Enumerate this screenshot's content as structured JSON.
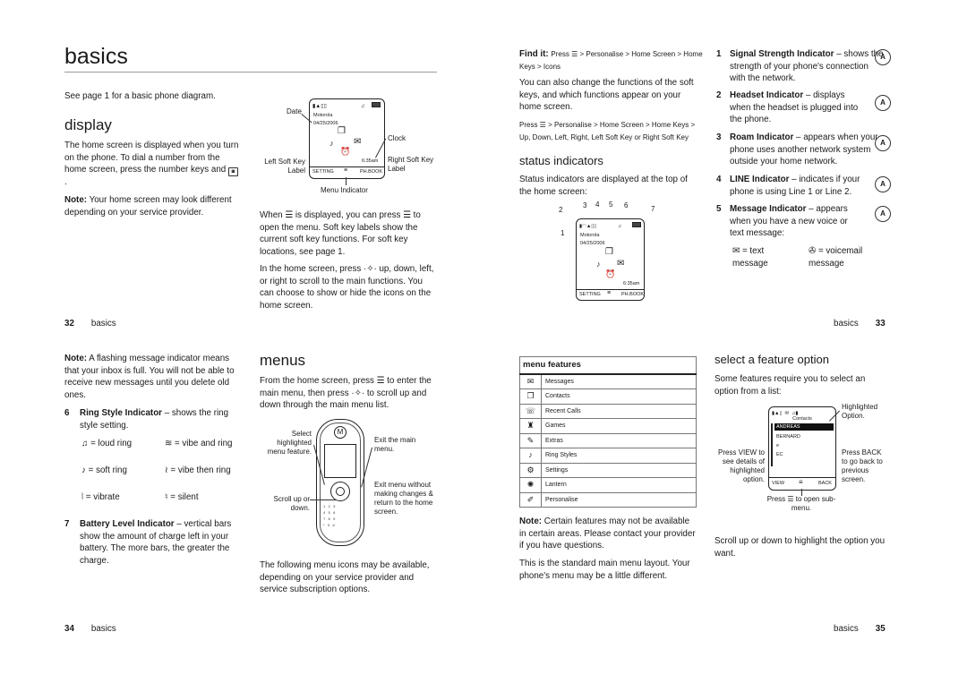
{
  "page32": {
    "title": "basics",
    "intro": "See page 1 for a basic phone diagram.",
    "section": "display",
    "para1": "The home screen is displayed when you turn on the phone. To dial a number from the home screen, press the number keys and",
    "note_label": "Note:",
    "note_text": "Your home screen may look different depending on your service provider.",
    "diagram": {
      "labels": {
        "date": "Date",
        "clock": "Clock",
        "left_soft_key": "Left Soft Key Label",
        "right_soft_key": "Right Soft Key Label",
        "menu_indicator": "Menu Indicator"
      },
      "screen": {
        "carrier": "Motorola",
        "date": "04/25/2006",
        "time": "6:35am",
        "left_soft": "SETTING",
        "right_soft": "PH.BOOK"
      }
    },
    "para2": "When ☰ is displayed, you can press ☰ to open the menu. Soft key labels show the current soft key functions. For soft key locations, see page 1.",
    "para3": "In the home screen, press ·✧· up, down, left, or right to scroll to the main functions. You can choose to show or hide the icons on the home screen.",
    "folio_num": "32",
    "folio_label": "basics"
  },
  "page33": {
    "findit_label": "Find it:",
    "findit_text": "Press ☰ > Personalise > Home Screen > Home Keys > Icons",
    "para1": "You can also change the functions of the soft keys, and which functions appear on your home screen.",
    "para2": "Press ☰ > Personalise > Home Screen > Home Keys > Up, Down, Left, Right, Left Soft Key or Right Soft Key",
    "section": "status indicators",
    "para3": "Status indicators are displayed at the top of the home screen:",
    "callouts": [
      "1",
      "2",
      "3",
      "4",
      "5",
      "6",
      "7"
    ],
    "screen": {
      "carrier": "Motorola",
      "date": "04/25/2006",
      "time": "6:35am",
      "left_soft": "SETTING",
      "right_soft": "PH.BOOK"
    },
    "indicators": [
      {
        "num": "1",
        "title": "Signal Strength Indicator",
        "text": " – shows the strength of your phone's connection with the network."
      },
      {
        "num": "2",
        "title": "Headset Indicator",
        "text": " – displays when the headset is plugged into the phone."
      },
      {
        "num": "3",
        "title": "Roam Indicator",
        "text": " – appears when your phone uses another network system outside your home network."
      },
      {
        "num": "4",
        "title": "LINE Indicator",
        "text": " – indicates if your phone is using Line 1 or Line 2."
      },
      {
        "num": "5",
        "title": "Message Indicator",
        "text": " – appears when you have a new voice or text message:"
      }
    ],
    "msg_types": [
      {
        "icon": "text-message-icon",
        "glyph": "✉",
        "label": "= text message"
      },
      {
        "icon": "voicemail-icon",
        "glyph": "✇",
        "label": "= voicemail message"
      }
    ],
    "folio_label": "basics",
    "folio_num": "33"
  },
  "page34": {
    "note_label": "Note:",
    "note_text": "A flashing message indicator means that your inbox is full. You will not be able to receive new messages until you delete old ones.",
    "item6_num": "6",
    "item6_title": "Ring Style Indicator",
    "item6_text": " – shows the ring style setting.",
    "ring_styles": [
      {
        "glyph": "♫",
        "label": "= loud ring"
      },
      {
        "glyph": "≋",
        "label": "= vibe and ring"
      },
      {
        "glyph": "♪",
        "label": "= soft ring"
      },
      {
        "glyph": "≀",
        "label": "= vibe then ring"
      },
      {
        "glyph": "⦚",
        "label": "= vibrate"
      },
      {
        "glyph": "♮",
        "label": "= silent"
      }
    ],
    "item7_num": "7",
    "item7_title": "Battery Level Indicator",
    "item7_text": " – vertical bars show the amount of charge left in your battery. The more bars, the greater the charge.",
    "section": "menus",
    "para1": "From the home screen, press ☰ to enter the main menu, then press ·✧· to scroll up and down through the main menu list.",
    "phone_labels": {
      "select": "Select highlighted menu feature.",
      "exit_main": "Exit the main menu.",
      "scroll": "Scroll up or down.",
      "exit_without": "Exit menu without making changes & return to the home screen."
    },
    "para2": "The following menu icons may be available, depending on your service provider and service subscription options.",
    "folio_num": "34",
    "folio_label": "basics"
  },
  "page35": {
    "menu_table": {
      "header": "menu features",
      "rows": [
        {
          "icon": "messages-icon",
          "glyph": "✉",
          "label": "Messages"
        },
        {
          "icon": "contacts-icon",
          "glyph": "❐",
          "label": "Contacts"
        },
        {
          "icon": "recent-calls-icon",
          "glyph": "☏",
          "label": "Recent Calls"
        },
        {
          "icon": "games-icon",
          "glyph": "♜",
          "label": "Games"
        },
        {
          "icon": "extras-icon",
          "glyph": "✎",
          "label": "Extras"
        },
        {
          "icon": "ring-styles-icon",
          "glyph": "♪",
          "label": "Ring Styles"
        },
        {
          "icon": "settings-icon",
          "glyph": "⚙",
          "label": "Settings"
        },
        {
          "icon": "lantern-icon",
          "glyph": "✺",
          "label": "Lantern"
        },
        {
          "icon": "personalise-icon",
          "glyph": "✐",
          "label": "Personalise"
        }
      ]
    },
    "note_label": "Note:",
    "note_text": "Certain features may not be available in certain areas. Please contact your provider if you have questions.",
    "para1": "This is the standard main menu layout. Your phone's menu may be a little different.",
    "section": "select a feature option",
    "para2": "Some features require you to select an option from a list:",
    "list_screen": {
      "title": "Contacts",
      "items": [
        "ANDREAS",
        "BERNARD",
        "e",
        "EC"
      ],
      "left_soft": "VIEW",
      "right_soft": "BACK"
    },
    "labels": {
      "highlighted": "Highlighted Option.",
      "view": "Press VIEW to see details of highlighted option.",
      "back": "Press BACK to go back to previous screen.",
      "submenu": "Press ☰ to open sub-menu."
    },
    "para3": "Scroll up or down to highlight the option you want.",
    "folio_label": "basics",
    "folio_num": "35"
  }
}
